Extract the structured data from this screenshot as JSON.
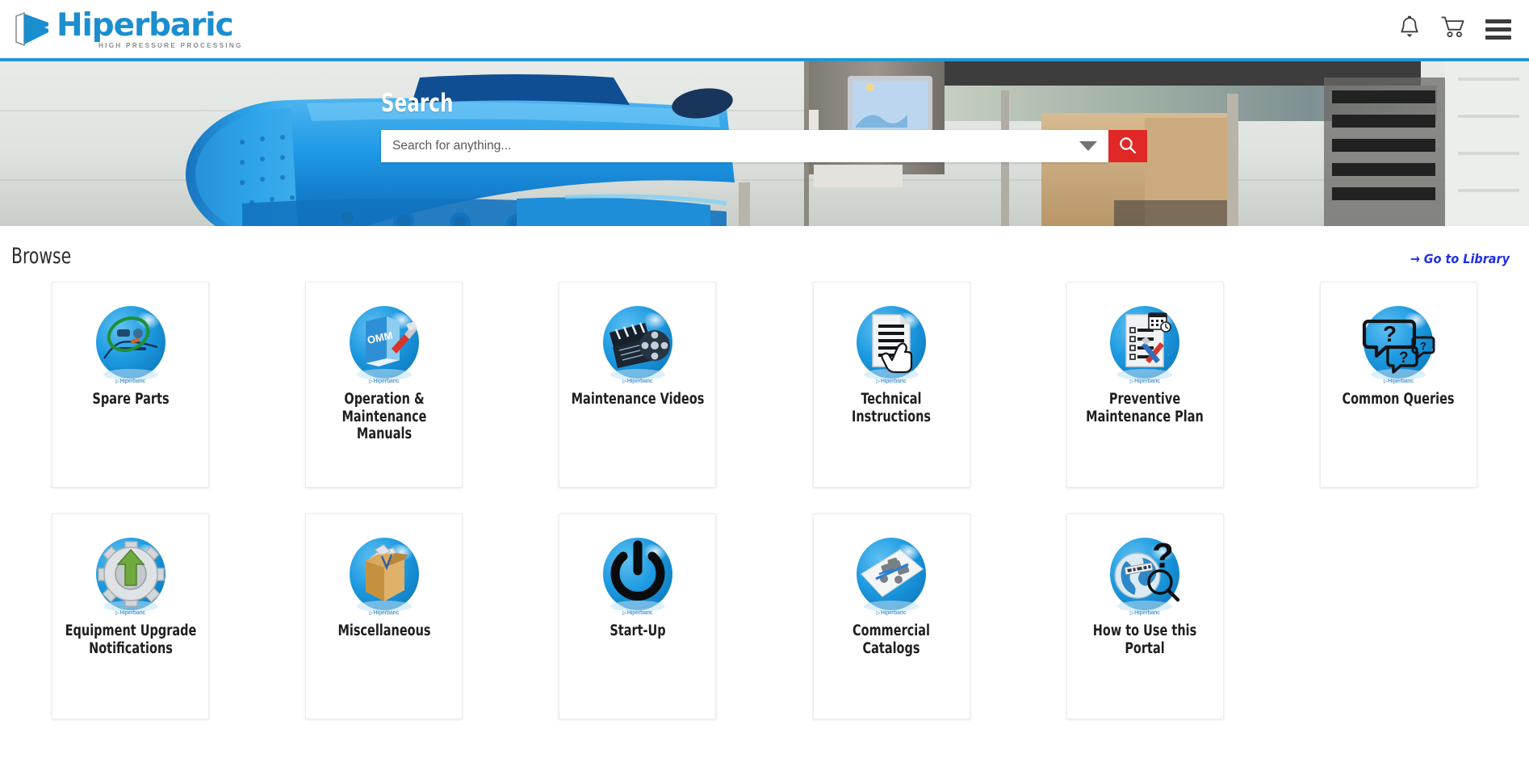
{
  "header": {
    "brand_name": "Hiperbaric",
    "brand_tagline": "HIGH PRESSURE PROCESSING",
    "icons": [
      {
        "name": "notifications-bell-icon",
        "label": "Notifications"
      },
      {
        "name": "shopping-cart-icon",
        "label": "Cart"
      },
      {
        "name": "menu-hamburger-icon",
        "label": "Menu"
      }
    ],
    "accent_color": "#2196d8"
  },
  "hero": {
    "title": "Search",
    "search_value": "",
    "search_placeholder": "Search for anything...",
    "dropdown_icon": "chevron-down-icon",
    "search_button_icon": "search-icon",
    "search_button_color": "#e02826"
  },
  "browse": {
    "title": "Browse",
    "library_link": "→ Go to Library",
    "library_link_color": "#2030e8"
  },
  "cards": [
    {
      "label": "Spare Parts",
      "icon": "spare-parts-icon",
      "watermark": "Hiperbaric"
    },
    {
      "label": "Operation & Maintenance Manuals",
      "icon": "omm-manual-icon",
      "watermark": "Hiperbaric"
    },
    {
      "label": "Maintenance Videos",
      "icon": "clapperboard-film-icon",
      "watermark": "Hiperbaric"
    },
    {
      "label": "Technical Instructions",
      "icon": "document-hand-icon",
      "watermark": "Hiperbaric"
    },
    {
      "label": "Preventive Maintenance Plan",
      "icon": "checklist-tools-icon",
      "watermark": "Hiperbaric"
    },
    {
      "label": "Common Queries",
      "icon": "speech-bubbles-icon",
      "watermark": "Hiperbaric"
    },
    {
      "label": "Equipment Upgrade Notifications",
      "icon": "gear-up-arrow-icon",
      "watermark": "Hiperbaric"
    },
    {
      "label": "Miscellaneous",
      "icon": "open-box-papers-icon",
      "watermark": "Hiperbaric"
    },
    {
      "label": "Start-Up",
      "icon": "power-button-icon",
      "watermark": "Hiperbaric"
    },
    {
      "label": "Commercial Catalogs",
      "icon": "catalog-sheet-icon",
      "watermark": "Hiperbaric"
    },
    {
      "label": "How to Use this Portal",
      "icon": "globe-question-icon",
      "watermark": "Hiperbaric"
    }
  ]
}
